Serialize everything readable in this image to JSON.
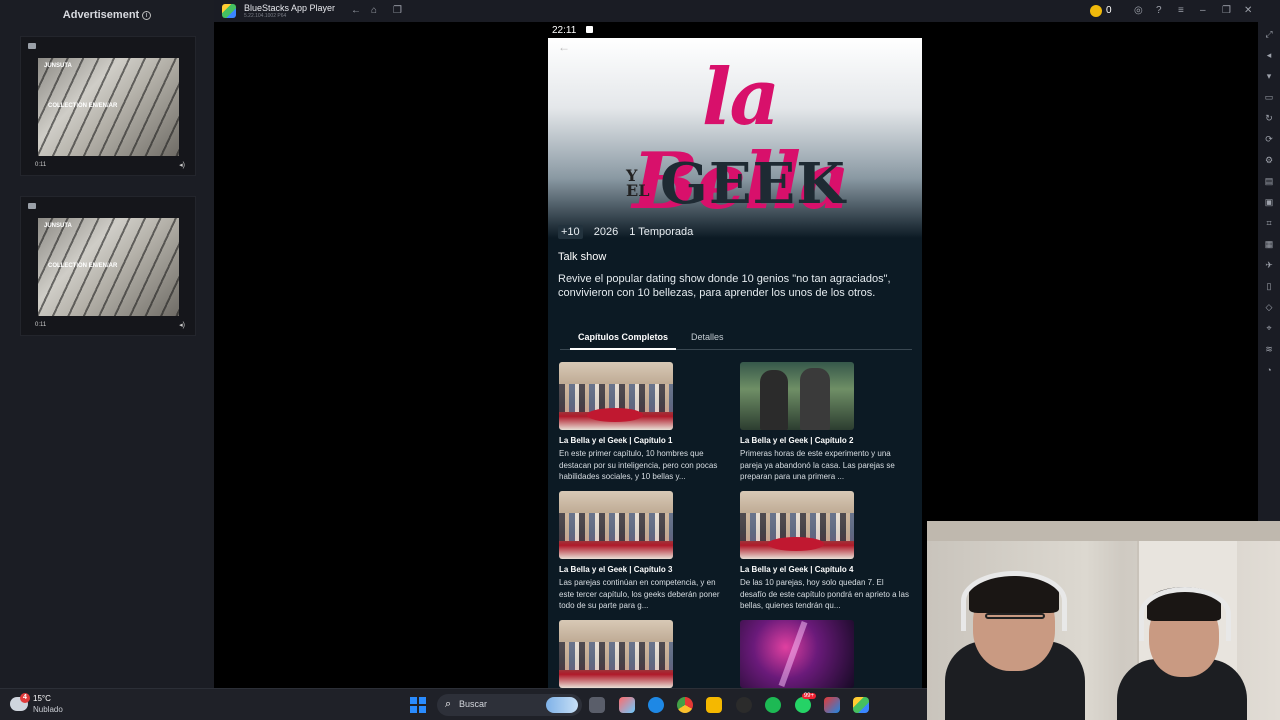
{
  "ad_panel": {
    "title": "Advertisement",
    "cards": [
      {
        "brand": "JUNSUTA",
        "caption": "COLLECTION EN/EN/AR",
        "time": "0:11"
      },
      {
        "brand": "JUNSUTA",
        "caption": "COLLECTION EN/EN/AR",
        "time": "0:11"
      }
    ]
  },
  "window": {
    "app_name": "BlueStacks App Player",
    "version": "5.22.104.1002 P64",
    "coins": "0"
  },
  "phone": {
    "clock": "22:11",
    "show": {
      "logo_line1": "la Bella",
      "logo_y": "Y",
      "logo_el": "EL",
      "logo_line2": "GEEK",
      "rating": "+10",
      "year": "2026",
      "seasons": "1 Temporada",
      "genre": "Talk show",
      "synopsis": "Revive el popular dating show donde 10 genios \"no tan agraciados\", convivieron con 10 bellezas, para aprender los unos de los otros."
    },
    "tabs": [
      "Capítulos Completos",
      "Detalles"
    ],
    "episodes": [
      {
        "title": "La Bella y el Geek | Capítulo 1",
        "desc": "En este primer capítulo, 10 hombres que destacan por su inteligencia, pero con pocas habilidades sociales, y 10 bellas y..."
      },
      {
        "title": "La Bella y el Geek | Capítulo 2",
        "desc": "Primeras horas de este experimento y una pareja ya abandonó la casa. Las parejas se preparan para una primera ..."
      },
      {
        "title": "La Bella y el Geek | Capítulo 3",
        "desc": "Las parejas continúan en competencia, y en este tercer capítulo, los geeks deberán poner todo de su parte para g..."
      },
      {
        "title": "La Bella y el Geek | Capítulo 4",
        "desc": "De las 10 parejas, hoy solo quedan 7. El desafío de este capítulo pondrá en aprieto a las bellas, quienes tendrán qu..."
      }
    ]
  },
  "taskbar": {
    "weather_temp": "15°C",
    "weather_desc": "Nublado",
    "weather_badge": "4",
    "search_label": "Buscar",
    "whatsapp_badge": "99+"
  }
}
